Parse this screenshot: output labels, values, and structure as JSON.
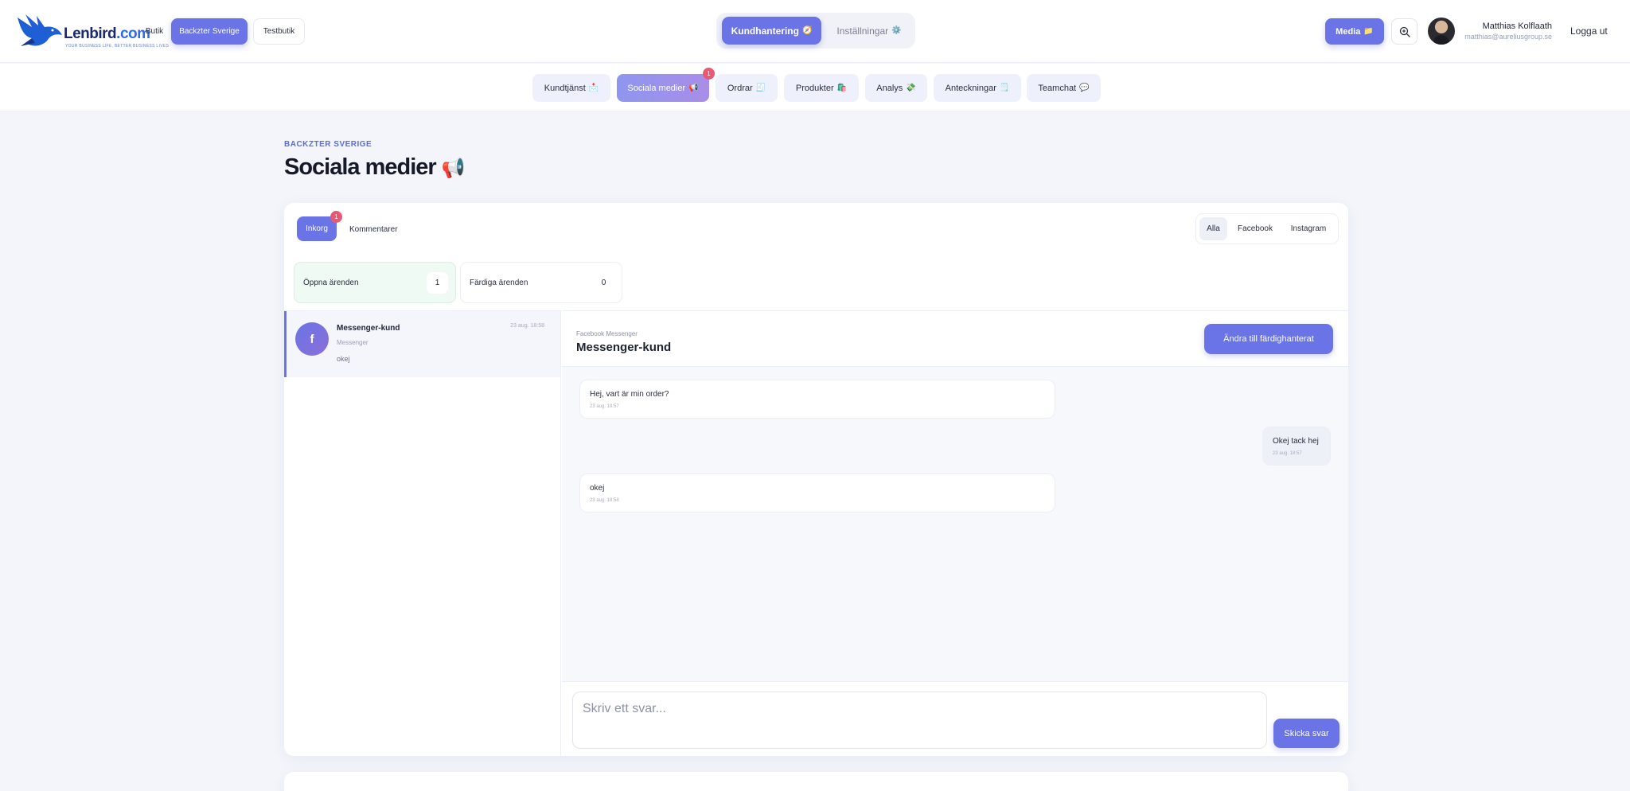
{
  "header": {
    "logo": {
      "brand": "Lenbird",
      "tld": ".com",
      "tagline": "YOUR BUSINESS LIFE, BETTER BUSINESS LIVES"
    },
    "stores": [
      "Butik",
      "Backzter Sverige",
      "Testbutik"
    ],
    "main_tabs": [
      {
        "label": "Kundhantering",
        "icon": "🧭"
      },
      {
        "label": "Inställningar",
        "icon": "⚙️"
      }
    ],
    "media_button": {
      "label": "Media",
      "icon": "📁"
    },
    "user": {
      "name": "Matthias Kolflaath",
      "email": "matthias@aureliusgroup.se"
    },
    "logout": "Logga ut"
  },
  "subnav": [
    {
      "label": "Kundtjänst",
      "icon": "📩"
    },
    {
      "label": "Sociala medier",
      "icon": "📢",
      "badge": "1"
    },
    {
      "label": "Ordrar",
      "icon": "🧾"
    },
    {
      "label": "Produkter",
      "icon": "🛍️"
    },
    {
      "label": "Analys",
      "icon": "💸"
    },
    {
      "label": "Anteckningar",
      "icon": "🗒️"
    },
    {
      "label": "Teamchat",
      "icon": "💬"
    }
  ],
  "page": {
    "eyebrow": "BACKZTER SVERIGE",
    "title": "Sociala medier",
    "title_icon": "📢"
  },
  "inbox": {
    "tabs": [
      {
        "label": "Inkorg",
        "badge": "1"
      },
      {
        "label": "Kommentarer"
      }
    ],
    "filters": [
      "Alla",
      "Facebook",
      "Instagram"
    ],
    "stats": [
      {
        "label": "Öppna ärenden",
        "value": "1"
      },
      {
        "label": "Färdiga ärenden",
        "value": "0"
      }
    ],
    "conversations": [
      {
        "avatar": "f",
        "name": "Messenger-kund",
        "channel": "Messenger",
        "last": "okej",
        "time": "23 aug. 18:58"
      }
    ]
  },
  "chat": {
    "source": "Facebook Messenger",
    "name": "Messenger-kund",
    "resolve_button": "Ändra till färdighanterat",
    "messages": [
      {
        "text": "Hej, vart är min order?",
        "time": "23 aug. 18:57"
      },
      {
        "text": "Okej tack hej",
        "time": "23 aug. 18:57"
      },
      {
        "text": "okej",
        "time": "23 aug. 18:58"
      }
    ],
    "reply_placeholder": "Skriv ett svar...",
    "send_button": "Skicka svar"
  },
  "colors": {
    "accent": "#6b74e6",
    "badge": "#e85a73",
    "open_stat": "#eefaf3"
  }
}
